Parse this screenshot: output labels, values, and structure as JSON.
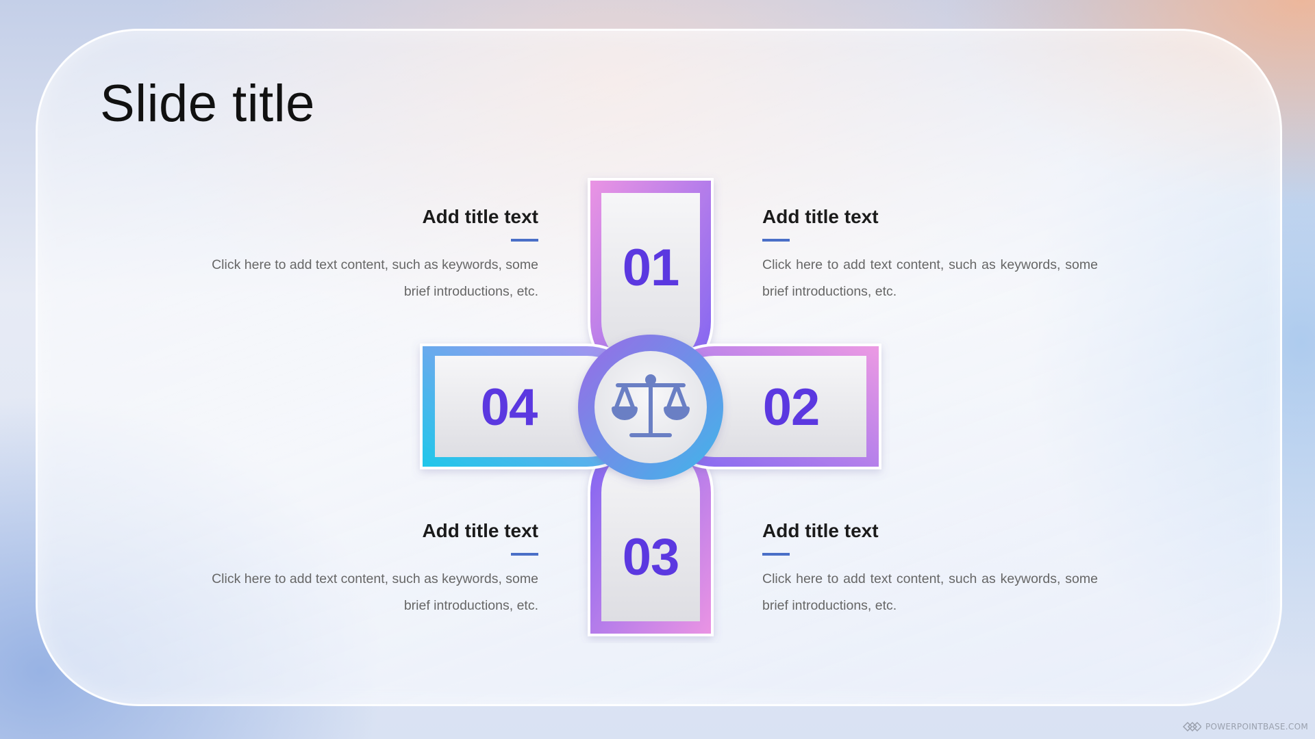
{
  "slide": {
    "title": "Slide title"
  },
  "items": [
    {
      "number": "01",
      "title": "Add title text",
      "text": "Click here to add text content, such as keywords, some brief introductions, etc."
    },
    {
      "number": "02",
      "title": "Add title text",
      "text": "Click here to add text content, such as keywords, some brief introductions, etc."
    },
    {
      "number": "03",
      "title": "Add title text",
      "text": "Click here to add text content, such as keywords, some brief introductions, etc."
    },
    {
      "number": "04",
      "title": "Add title text",
      "text": "Click here to add text content, such as keywords, some brief introductions, etc."
    }
  ],
  "center_icon": "balance-scale-icon",
  "watermark": "POWERPOINTBASE.COM",
  "colors": {
    "number": "#5b38e0",
    "accent_line": "#4a6fc7",
    "gradient_pink": "#e98fe0",
    "gradient_violet": "#8b6cf0",
    "gradient_cyan": "#22c4ea"
  }
}
